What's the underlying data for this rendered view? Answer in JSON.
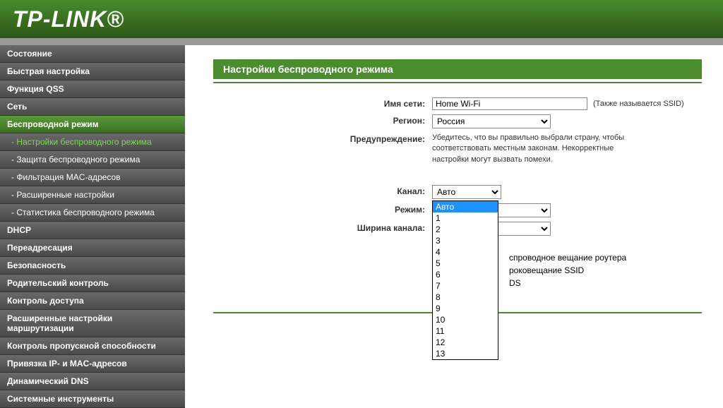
{
  "logo": "TP-LINK®",
  "sidebar": {
    "items": [
      {
        "label": "Состояние",
        "type": "menu"
      },
      {
        "label": "Быстрая настройка",
        "type": "menu"
      },
      {
        "label": "Функция QSS",
        "type": "menu"
      },
      {
        "label": "Сеть",
        "type": "menu"
      },
      {
        "label": "Беспроводной режим",
        "type": "menu",
        "active": true
      },
      {
        "label": "- Настройки беспроводного режима",
        "type": "sub",
        "active": true
      },
      {
        "label": "- Защита беспроводного режима",
        "type": "sub"
      },
      {
        "label": "- Фильтрация MAC-адресов",
        "type": "sub"
      },
      {
        "label": "- Расширенные настройки",
        "type": "sub"
      },
      {
        "label": "- Статистика беспроводного режима",
        "type": "sub"
      },
      {
        "label": "DHCP",
        "type": "menu"
      },
      {
        "label": "Переадресация",
        "type": "menu"
      },
      {
        "label": "Безопасность",
        "type": "menu"
      },
      {
        "label": "Родительский контроль",
        "type": "menu"
      },
      {
        "label": "Контроль доступа",
        "type": "menu"
      },
      {
        "label": "Расширенные настройки маршрутизации",
        "type": "menu"
      },
      {
        "label": "Контроль пропускной способности",
        "type": "menu"
      },
      {
        "label": "Привязка IP- и MAC-адресов",
        "type": "menu"
      },
      {
        "label": "Динамический DNS",
        "type": "menu"
      },
      {
        "label": "Системные инструменты",
        "type": "menu"
      }
    ]
  },
  "section_title": "Настройки беспроводного режима",
  "labels": {
    "ssid": "Имя сети:",
    "region": "Регион:",
    "warning": "Предупреждение:",
    "channel": "Канал:",
    "mode": "Режим:",
    "width": "Ширина канала:"
  },
  "values": {
    "ssid": "Home Wi-Fi",
    "region": "Россия",
    "channel": "Авто",
    "mode": "",
    "width": ""
  },
  "hints": {
    "ssid": "(Также называется SSID)"
  },
  "warning_text": "Убедитесь, что вы правильно выбрали страну, чтобы соответствовать местным законам. Некорректные настройки могут вызвать помехи.",
  "checkboxes": {
    "broadcast": "спроводное вещание роутера",
    "ssid_broadcast": "роковещание SSID",
    "wds": "DS"
  },
  "channel_options": [
    "Авто",
    "1",
    "2",
    "3",
    "4",
    "5",
    "6",
    "7",
    "8",
    "9",
    "10",
    "11",
    "12",
    "13"
  ]
}
